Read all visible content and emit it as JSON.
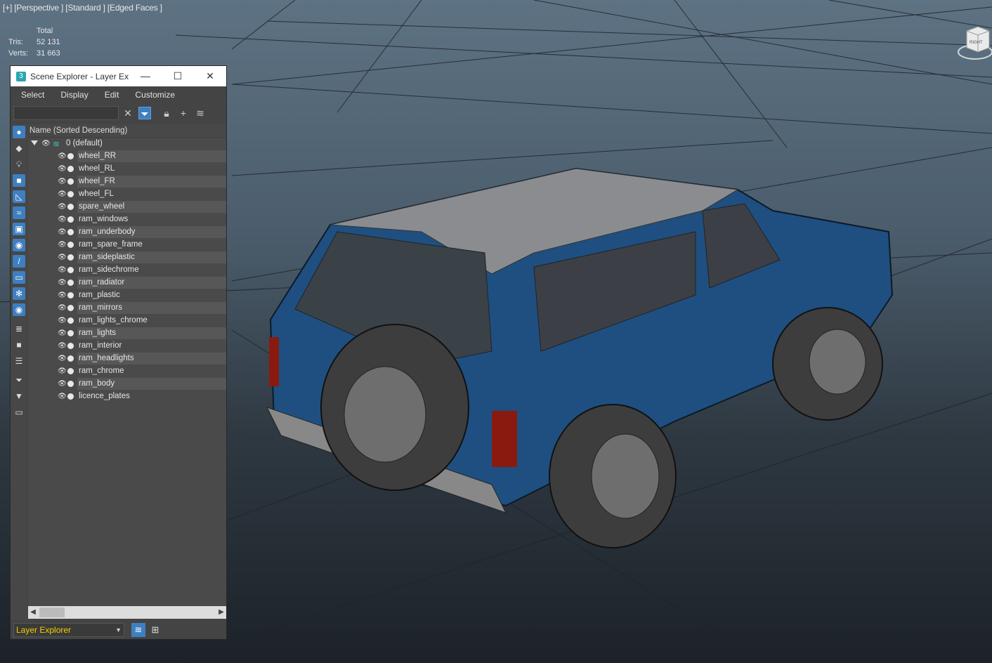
{
  "viewport": {
    "label": "[+] [Perspective ] [Standard ] [Edged Faces ]",
    "stats": {
      "header": "Total",
      "tris_label": "Tris:",
      "tris_value": "52 131",
      "verts_label": "Verts:",
      "verts_value": "31 663"
    },
    "viewcube_label": "RIGHT"
  },
  "window": {
    "title": "Scene Explorer - Layer Ex...",
    "app_icon": "3",
    "menu": [
      "Select",
      "Display",
      "Edit",
      "Customize"
    ],
    "search_value": "",
    "column_header": "Name (Sorted Descending)",
    "parent_layer": "0 (default)",
    "items": [
      "wheel_RR",
      "wheel_RL",
      "wheel_FR",
      "wheel_FL",
      "spare_wheel",
      "ram_windows",
      "ram_underbody",
      "ram_spare_frame",
      "ram_sideplastic",
      "ram_sidechrome",
      "ram_radiator",
      "ram_plastic",
      "ram_mirrors",
      "ram_lights_chrome",
      "ram_lights",
      "ram_interior",
      "ram_headlights",
      "ram_chrome",
      "ram_body",
      "licence_plates"
    ],
    "explorer_mode": "Layer Explorer"
  },
  "colors": {
    "accent": "#3d7fc1",
    "layer_mode_text": "#f0d000",
    "vehicle_body": "#1e4f80"
  }
}
